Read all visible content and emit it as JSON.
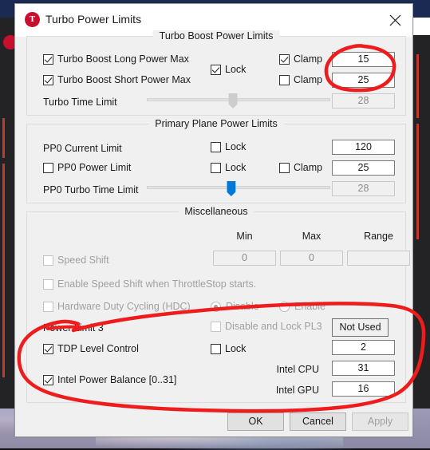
{
  "window": {
    "title": "Turbo Power Limits",
    "icon": "throttlestop-icon",
    "icon_letter": "T",
    "close_icon": "close-icon"
  },
  "groups": {
    "turbo_boost": {
      "title": "Turbo Boost Power Limits",
      "rows": [
        {
          "label": "Turbo Boost Long Power Max",
          "checked": true,
          "clamp_label": "Clamp",
          "clamp_checked": true,
          "value": "15"
        },
        {
          "label": "Turbo Boost Short Power Max",
          "checked": true,
          "clamp_label": "Clamp",
          "clamp_checked": false,
          "value": "25"
        },
        {
          "label": "Turbo Time Limit",
          "value": "28"
        }
      ],
      "lock_label": "Lock",
      "lock_checked": true,
      "slider_percent": 47
    },
    "primary_plane": {
      "title": "Primary Plane Power Limits",
      "rows": [
        {
          "label": "PP0 Current Limit",
          "lock_label": "Lock",
          "lock_checked": false,
          "value": "120"
        },
        {
          "label": "PP0 Power Limit",
          "checked": false,
          "lock_label": "Lock",
          "lock_checked": false,
          "clamp_label": "Clamp",
          "clamp_checked": false,
          "value": "25"
        },
        {
          "label": "PP0 Turbo Time Limit",
          "value": "28"
        }
      ],
      "slider_percent": 46
    },
    "miscellaneous": {
      "title": "Miscellaneous",
      "column_headers": [
        "Min",
        "Max",
        "Range"
      ],
      "speed_shift": {
        "label": "Speed Shift",
        "checked": false,
        "min": "0",
        "max": "0",
        "range": ""
      },
      "enable_speed_shift": {
        "label": "Enable Speed Shift when ThrottleStop starts.",
        "checked": false
      },
      "hdc": {
        "label": "Hardware Duty Cycling (HDC)",
        "checked": false,
        "options": [
          {
            "label": "Disable",
            "selected": true
          },
          {
            "label": "Enable",
            "selected": false
          }
        ]
      },
      "power_limit_3": {
        "label": "Power Limit 3",
        "disable_lock_label": "Disable and Lock PL3",
        "disable_lock_checked": false,
        "value": "Not Used"
      },
      "tdp_level_control": {
        "label": "TDP Level Control",
        "checked": true,
        "lock_label": "Lock",
        "lock_checked": false,
        "value": "2"
      },
      "intel_power_balance": {
        "label": "Intel Power Balance  [0..31]",
        "checked": true,
        "cpu_label": "Intel CPU",
        "cpu_value": "31",
        "gpu_label": "Intel GPU",
        "gpu_value": "16"
      }
    }
  },
  "footer": {
    "ok": "OK",
    "cancel": "Cancel",
    "apply": "Apply",
    "apply_disabled": true
  },
  "annotations": {
    "color": "#ee1c1c",
    "marks": [
      {
        "name": "circle-around-turbo-values",
        "shape": "ellipse"
      },
      {
        "name": "circle-around-tdp-and-power-balance",
        "shape": "ellipse"
      }
    ]
  }
}
